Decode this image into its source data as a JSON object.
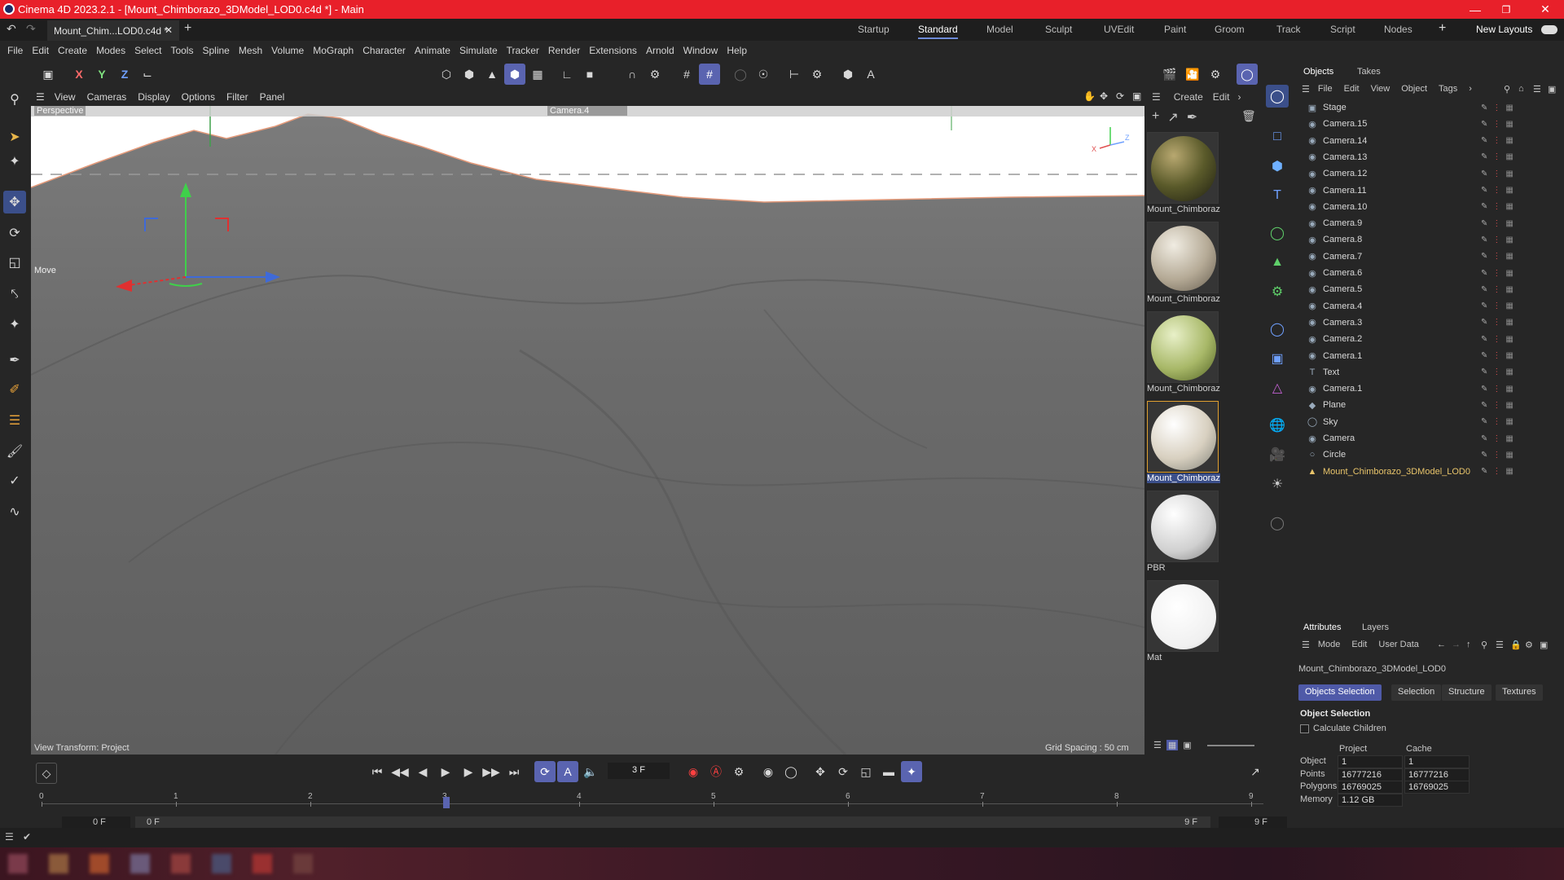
{
  "window": {
    "title": "Cinema 4D 2023.2.1 - [Mount_Chimborazo_3DModel_LOD0.c4d *] - Main"
  },
  "doc_tab": {
    "label": "Mount_Chim...LOD0.c4d *"
  },
  "layouts": {
    "items": [
      "Startup",
      "Standard",
      "Model",
      "Sculpt",
      "UVEdit",
      "Paint",
      "Groom",
      "Track",
      "Script",
      "Nodes"
    ],
    "active": "Standard",
    "new_layouts": "New Layouts"
  },
  "menu": [
    "File",
    "Edit",
    "Create",
    "Modes",
    "Select",
    "Tools",
    "Spline",
    "Mesh",
    "Volume",
    "MoGraph",
    "Character",
    "Animate",
    "Simulate",
    "Tracker",
    "Render",
    "Extensions",
    "Arnold",
    "Window",
    "Help"
  ],
  "axis_toggles": [
    "X",
    "Y",
    "Z"
  ],
  "viewport": {
    "menu": [
      "View",
      "Cameras",
      "Display",
      "Options",
      "Filter",
      "Panel"
    ],
    "name": "Perspective",
    "camera": "Camera.4",
    "tool_label": "Move",
    "view_transform": "View Transform: Project",
    "grid_spacing": "Grid Spacing : 50 cm"
  },
  "materials": {
    "menu": [
      "Create",
      "Edit"
    ],
    "items": [
      {
        "name": "Mount_Chimboraz"
      },
      {
        "name": "Mount_Chimboraz"
      },
      {
        "name": "Mount_Chimboraz"
      },
      {
        "name": "Mount_Chimboraz"
      },
      {
        "name": "PBR"
      },
      {
        "name": "Mat"
      }
    ]
  },
  "objects": {
    "tabs": [
      "Objects",
      "Takes"
    ],
    "menu": [
      "File",
      "Edit",
      "View",
      "Object",
      "Tags"
    ],
    "rows": [
      {
        "name": "Stage",
        "icon": "stage-icon"
      },
      {
        "name": "Camera.15",
        "icon": "camera-icon"
      },
      {
        "name": "Camera.14",
        "icon": "camera-icon"
      },
      {
        "name": "Camera.13",
        "icon": "camera-icon"
      },
      {
        "name": "Camera.12",
        "icon": "camera-icon"
      },
      {
        "name": "Camera.11",
        "icon": "camera-icon"
      },
      {
        "name": "Camera.10",
        "icon": "camera-icon"
      },
      {
        "name": "Camera.9",
        "icon": "camera-icon"
      },
      {
        "name": "Camera.8",
        "icon": "camera-icon"
      },
      {
        "name": "Camera.7",
        "icon": "camera-icon"
      },
      {
        "name": "Camera.6",
        "icon": "camera-icon"
      },
      {
        "name": "Camera.5",
        "icon": "camera-icon"
      },
      {
        "name": "Camera.4",
        "icon": "camera-icon"
      },
      {
        "name": "Camera.3",
        "icon": "camera-icon"
      },
      {
        "name": "Camera.2",
        "icon": "camera-icon"
      },
      {
        "name": "Camera.1",
        "icon": "camera-icon"
      },
      {
        "name": "Text",
        "icon": "text-icon"
      },
      {
        "name": "Camera.1",
        "icon": "camera-icon"
      },
      {
        "name": "Plane",
        "icon": "plane-icon"
      },
      {
        "name": "Sky",
        "icon": "sky-icon"
      },
      {
        "name": "Camera",
        "icon": "camera-icon"
      },
      {
        "name": "Circle",
        "icon": "circle-icon"
      },
      {
        "name": "Mount_Chimborazo_3DModel_LOD0",
        "icon": "mesh-icon"
      }
    ]
  },
  "attributes": {
    "tabs": [
      "Attributes",
      "Layers"
    ],
    "menu": [
      "Mode",
      "Edit",
      "User Data"
    ],
    "object_name": "Mount_Chimborazo_3DModel_LOD0",
    "subtabs": [
      "Objects Selection",
      "Selection",
      "Structure",
      "Textures"
    ],
    "section_title": "Object Selection",
    "calc_children": "Calculate Children",
    "col_project": "Project",
    "col_cache": "Cache",
    "rows": [
      {
        "label": "Object",
        "project": "1",
        "cache": "1"
      },
      {
        "label": "Points",
        "project": "16777216",
        "cache": "16777216"
      },
      {
        "label": "Polygons",
        "project": "16769025",
        "cache": "16769025"
      },
      {
        "label": "Memory",
        "project": "1.12 GB",
        "cache": ""
      }
    ]
  },
  "timeline": {
    "current_frame": "3 F",
    "ticks": [
      "0",
      "1",
      "2",
      "3",
      "4",
      "5",
      "6",
      "7",
      "8",
      "9"
    ],
    "start_field": "0 F",
    "start_field2": "0 F",
    "end_field": "9 F",
    "end_field2": "9 F"
  },
  "colors": {
    "titlebar": "#e8202a",
    "accent": "#5a64b0",
    "selected_object": "#e8c46a"
  }
}
